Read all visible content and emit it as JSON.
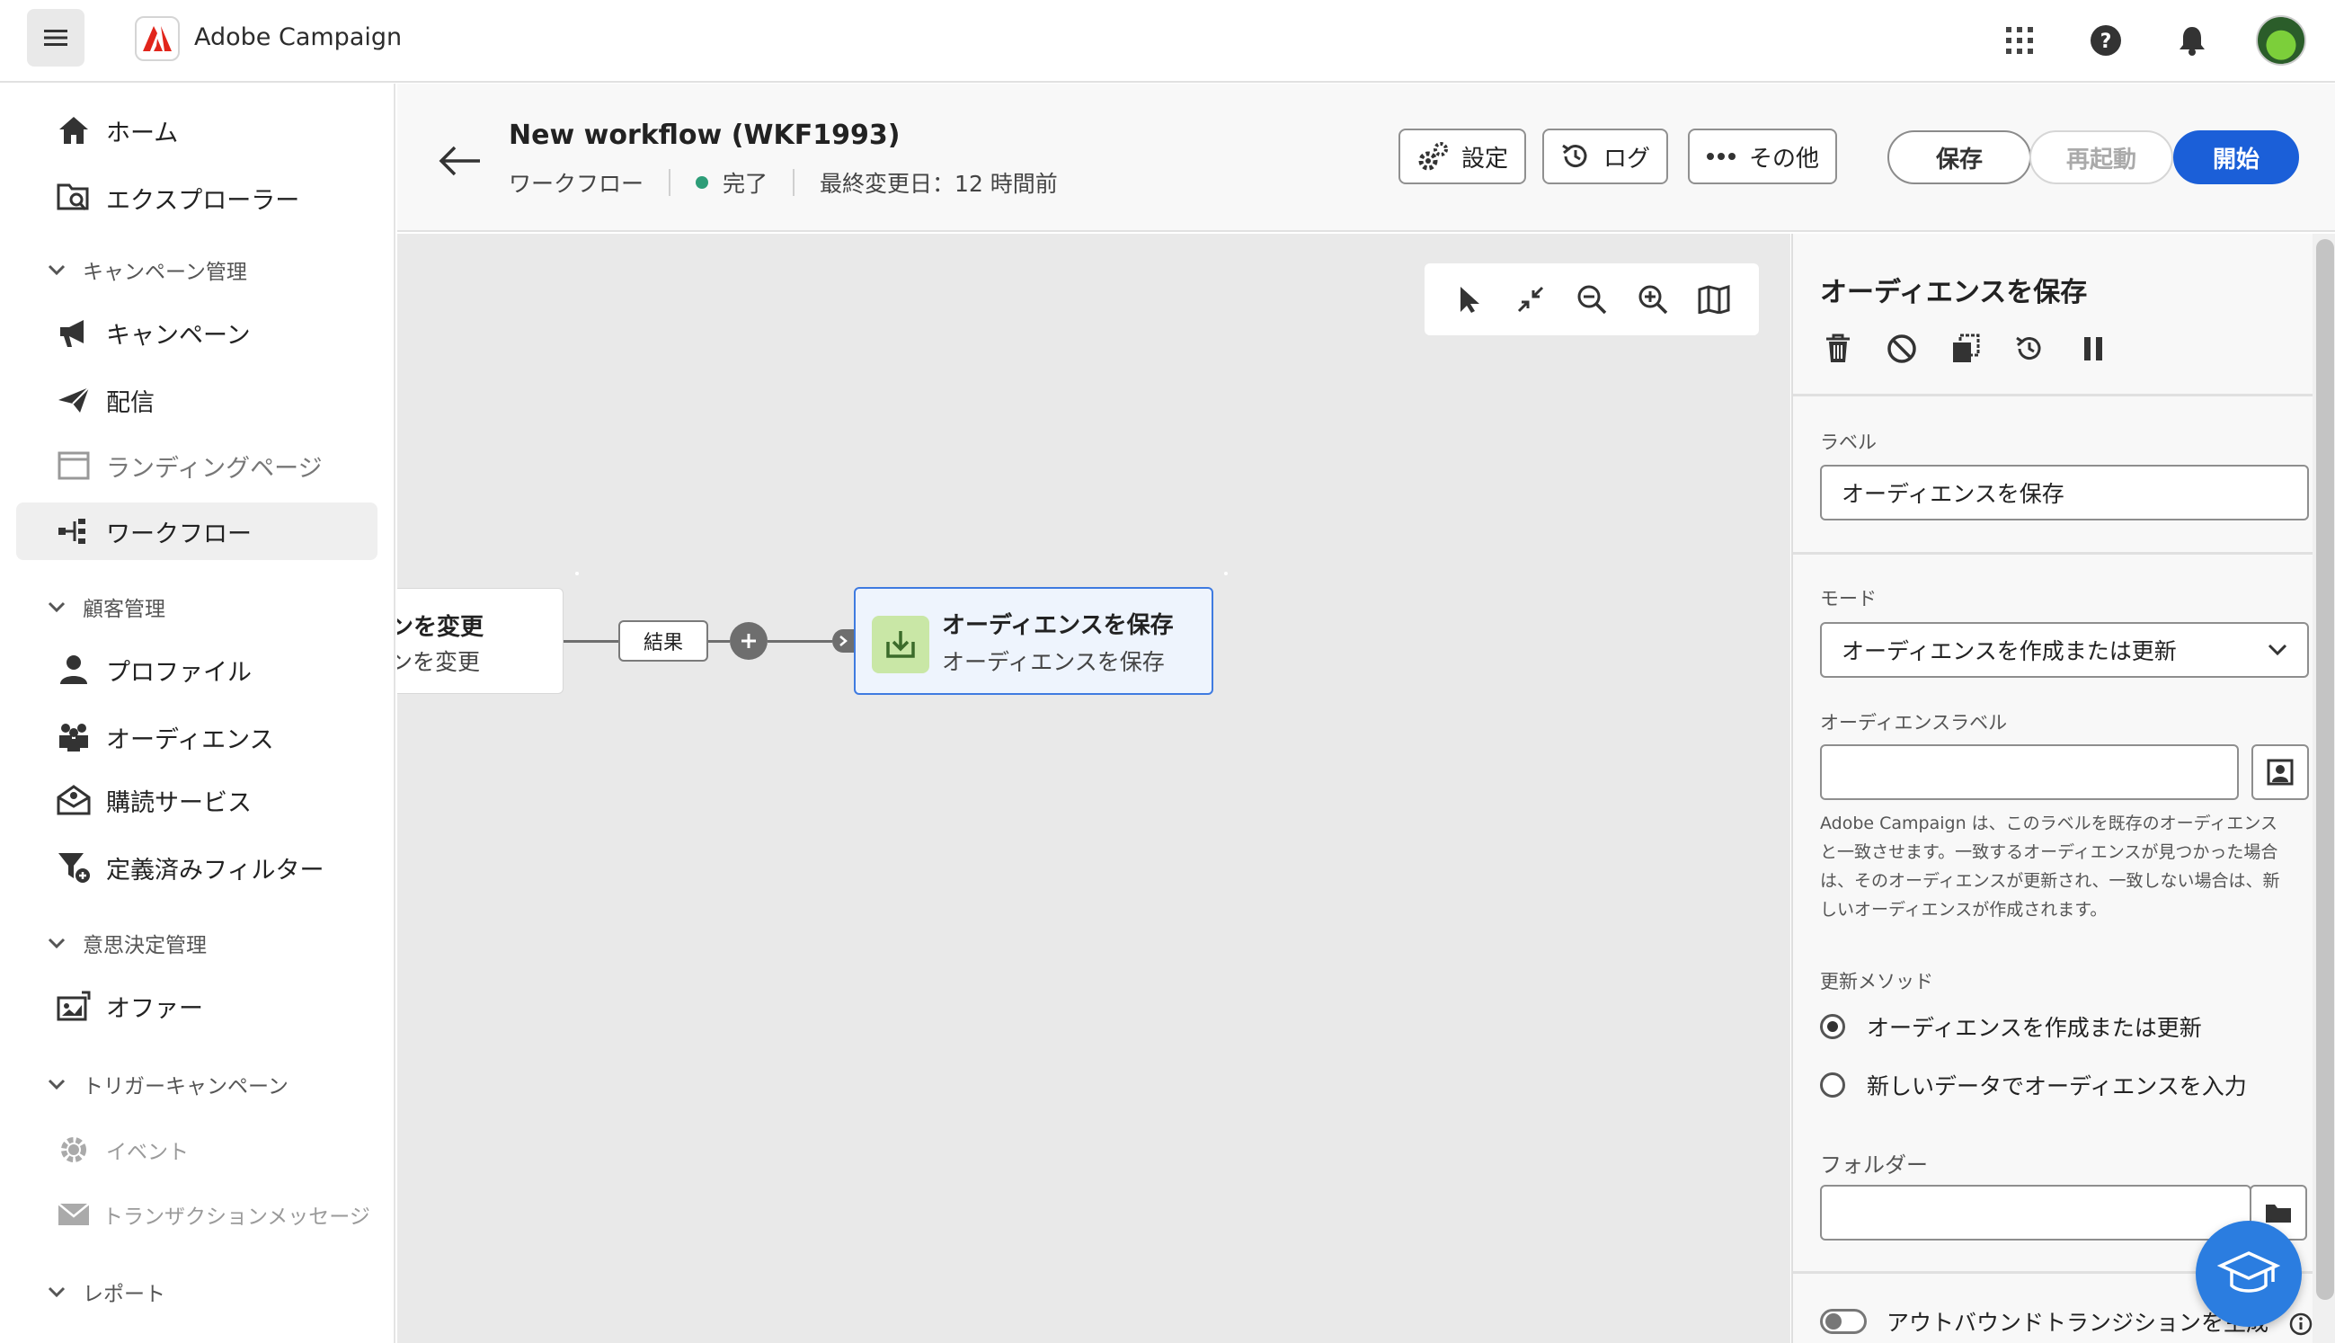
{
  "app": {
    "name": "Adobe Campaign"
  },
  "sidebar": {
    "items": [
      {
        "label": "ホーム",
        "icon": "home-icon"
      },
      {
        "label": "エクスプローラー",
        "icon": "explorer-icon"
      },
      {
        "label": "キャンペーン",
        "icon": "megaphone-icon"
      },
      {
        "label": "配信",
        "icon": "send-icon"
      },
      {
        "label": "ランディングページ",
        "icon": "landing-page-icon"
      },
      {
        "label": "ワークフロー",
        "icon": "workflow-icon",
        "active": true
      },
      {
        "label": "プロファイル",
        "icon": "user-icon"
      },
      {
        "label": "オーディエンス",
        "icon": "audience-icon"
      },
      {
        "label": "購読サービス",
        "icon": "subscription-icon"
      },
      {
        "label": "定義済みフィルター",
        "icon": "filter-icon"
      },
      {
        "label": "オファー",
        "icon": "offer-icon"
      },
      {
        "label": "イベント",
        "icon": "event-gear-icon"
      },
      {
        "label": "トランザクションメッセージ",
        "icon": "mail-icon"
      }
    ],
    "sections": [
      {
        "label": "キャンペーン管理"
      },
      {
        "label": "顧客管理"
      },
      {
        "label": "意思決定管理"
      },
      {
        "label": "トリガーキャンペーン"
      },
      {
        "label": "レポート"
      }
    ]
  },
  "header": {
    "title": "New workflow (WKF1993)",
    "type": "ワークフロー",
    "status": "完了",
    "last_modified": "最終変更日：12 時間前",
    "settings_label": "設定",
    "log_label": "ログ",
    "more_label": "その他",
    "save_label": "保存",
    "restart_label": "再起動",
    "start_label": "開始"
  },
  "canvas": {
    "prev_node": {
      "title": "ンを変更",
      "subtitle": "ンを変更"
    },
    "transition_label": "結果",
    "node": {
      "title": "オーディエンスを保存",
      "subtitle": "オーディエンスを保存"
    }
  },
  "panel": {
    "title": "オーディエンスを保存",
    "label_field": {
      "label": "ラベル",
      "value": "オーディエンスを保存"
    },
    "mode": {
      "label": "モード",
      "value": "オーディエンスを作成または更新"
    },
    "audience_label": {
      "label": "オーディエンスラベル",
      "value": ""
    },
    "help_text": "Adobe Campaign は、このラベルを既存のオーディエンスと一致させます。一致するオーディエンスが見つかった場合は、そのオーディエンスが更新され、一致しない場合は、新しいオーディエンスが作成されます。",
    "update_method": {
      "label": "更新メソッド",
      "options": [
        "オーディエンスを作成または更新",
        "新しいデータでオーディエンスを入力"
      ],
      "selected": 0
    },
    "folder": {
      "label": "フォルダー",
      "value": ""
    },
    "outbound_toggle": {
      "label": "アウトバウンドトランジションを生成",
      "on": false
    }
  },
  "colors": {
    "accent": "#1b5fd8",
    "status_done": "#2d9d78",
    "node_selected_border": "#3f7be0",
    "node_icon_bg": "#c9e7a6",
    "fab": "#2b7de0"
  }
}
